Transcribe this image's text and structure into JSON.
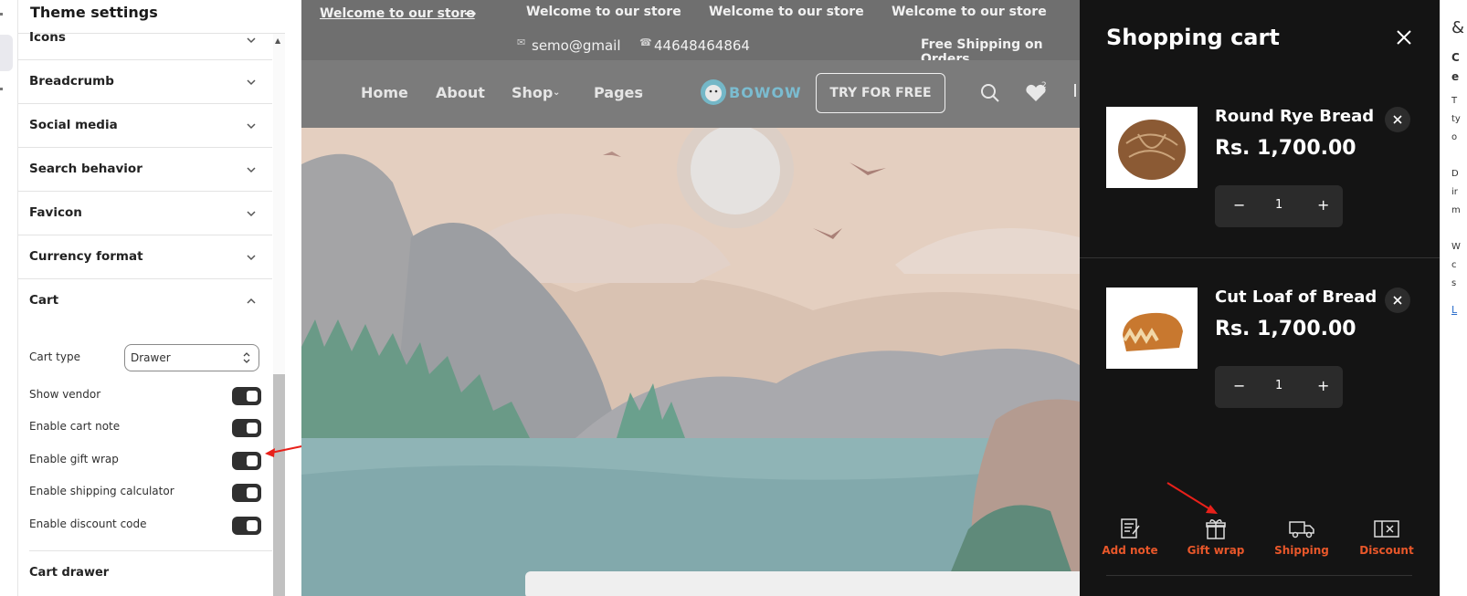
{
  "panel": {
    "title": "Theme settings",
    "sections": [
      "Icons",
      "Breadcrumb",
      "Social media",
      "Search behavior",
      "Favicon",
      "Currency format"
    ],
    "cart": {
      "label": "Cart",
      "cart_type_label": "Cart type",
      "cart_type_value": "Drawer",
      "toggles": [
        "Show vendor",
        "Enable cart note",
        "Enable gift wrap",
        "Enable shipping calculator",
        "Enable discount code"
      ],
      "toggle_states": [
        true,
        true,
        true,
        true,
        true
      ]
    },
    "next_section": "Cart drawer"
  },
  "store": {
    "announcements": [
      "Welcome to our store",
      "Welcome to our store",
      "Welcome to our store",
      "Welcome to our store"
    ],
    "email": "semo@gmail",
    "phone": "44648464864",
    "shipping": "Free Shipping on Orders",
    "nav": [
      "Home",
      "About",
      "Shop",
      "Pages"
    ],
    "logo": "BOWOW",
    "try_button": "TRY FOR FREE",
    "wishlist_count": "2"
  },
  "cart": {
    "title": "Shopping cart",
    "items": [
      {
        "name": "Round Rye Bread",
        "price": "Rs. 1,700.00",
        "qty": "1"
      },
      {
        "name": "Cut Loaf of Bread",
        "price": "Rs. 1,700.00",
        "qty": "1"
      }
    ],
    "tools": [
      "Add note",
      "Gift wrap",
      "Shipping",
      "Discount"
    ],
    "accent": "#e8572a"
  },
  "right_pane": {
    "letters": [
      "C",
      "e",
      "T",
      "ty",
      "o",
      "D",
      "ir",
      "m",
      "W",
      "c",
      "s",
      "L"
    ]
  }
}
